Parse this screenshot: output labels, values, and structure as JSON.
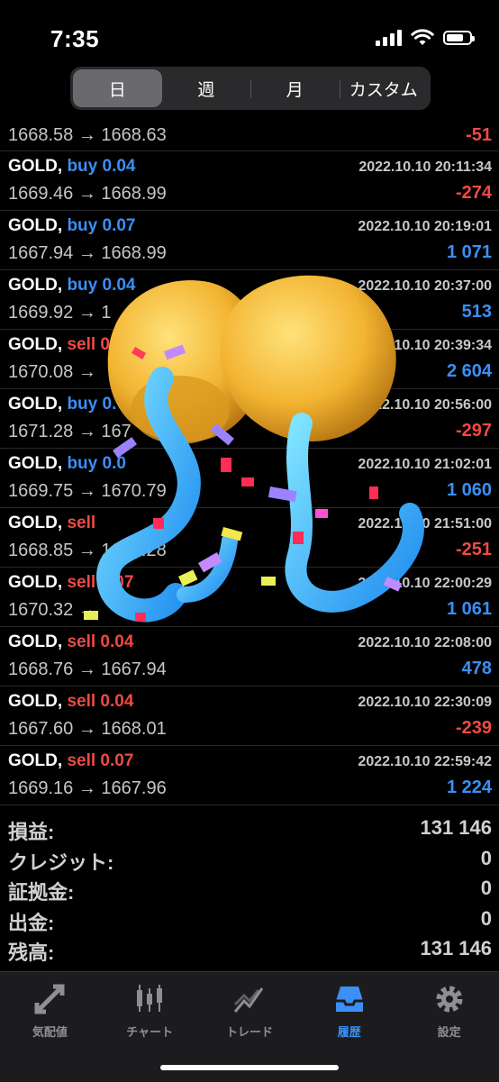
{
  "status_bar": {
    "time": "7:35"
  },
  "segments": [
    {
      "label": "日",
      "active": true
    },
    {
      "label": "週",
      "active": false
    },
    {
      "label": "月",
      "active": false
    },
    {
      "label": "カスタム",
      "active": false
    }
  ],
  "first_row": {
    "prices": "1668.58 → 1668.63",
    "profit": "-51"
  },
  "trades": [
    {
      "symbol": "GOLD,",
      "side": "buy 0.04",
      "datetime": "2022.10.10 20:11:34",
      "prices": "1669.46 → 1668.99",
      "profit": "-274"
    },
    {
      "symbol": "GOLD,",
      "side": "buy 0.07",
      "datetime": "2022.10.10 20:19:01",
      "prices": "1667.94 → 1668.99",
      "profit": "1 071"
    },
    {
      "symbol": "GOLD,",
      "side": "buy 0.04",
      "datetime": "2022.10.10 20:37:00",
      "prices": "1669.92 → 1",
      "profit": "513"
    },
    {
      "symbol": "GOLD,",
      "side": "sell 0",
      "datetime": "10.10 20:39:34",
      "prices": "1670.08 →",
      "profit": "2 604"
    },
    {
      "symbol": "GOLD,",
      "side": "buy 0.",
      "datetime": "2022.10.10 20:56:00",
      "prices": "1671.28 → 167",
      "profit": "-297"
    },
    {
      "symbol": "GOLD,",
      "side": "buy 0.0",
      "datetime": "2022.10.10 21:02:01",
      "prices": "1669.75 → 1670.79",
      "profit": "1 060"
    },
    {
      "symbol": "GOLD,",
      "side": "sell",
      "datetime": "2022.10.10 21:51:00",
      "prices": "1668.85 → 1669.28",
      "profit": "-251"
    },
    {
      "symbol": "GOLD,",
      "side": "sell 0.07",
      "datetime": "2022.10.10 22:00:29",
      "prices": "1670.32 →",
      "profit": "1 061"
    },
    {
      "symbol": "GOLD,",
      "side": "sell 0.04",
      "datetime": "2022.10.10 22:08:00",
      "prices": "1668.76 → 1667.94",
      "profit": "478"
    },
    {
      "symbol": "GOLD,",
      "side": "sell 0.04",
      "datetime": "2022.10.10 22:30:09",
      "prices": "1667.60 → 1668.01",
      "profit": "-239"
    },
    {
      "symbol": "GOLD,",
      "side": "sell 0.07",
      "datetime": "2022.10.10 22:59:42",
      "prices": "1669.16 → 1667.96",
      "profit": "1 224"
    }
  ],
  "summary": [
    {
      "label": "損益:",
      "value": "131 146"
    },
    {
      "label": "クレジット:",
      "value": "0"
    },
    {
      "label": "証拠金:",
      "value": "0"
    },
    {
      "label": "出金:",
      "value": "0"
    },
    {
      "label": "残高:",
      "value": "131 146"
    }
  ],
  "tabs": [
    {
      "label": "気配値",
      "icon": "quotes-icon",
      "active": false
    },
    {
      "label": "チャート",
      "icon": "candlestick-icon",
      "active": false
    },
    {
      "label": "トレード",
      "icon": "trade-icon",
      "active": false
    },
    {
      "label": "履歴",
      "icon": "history-inbox-icon",
      "active": true
    },
    {
      "label": "設定",
      "icon": "gear-icon",
      "active": false
    }
  ],
  "colors": {
    "buy": "#3b8ff5",
    "sell": "#ee4a43",
    "positive": "#3b8ff5",
    "negative": "#ee4a43",
    "active_tab": "#3b8ff5"
  }
}
